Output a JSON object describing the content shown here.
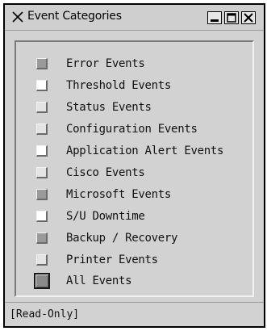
{
  "window": {
    "title": "Event Categories",
    "title_icon": "close-x-icon",
    "controls": {
      "minimize_icon": "minimize-icon",
      "maximize_icon": "maximize-icon",
      "close_icon": "close-icon"
    },
    "background": "#d2d2d2"
  },
  "categories": [
    {
      "label": "Error Events",
      "swatch": "grey"
    },
    {
      "label": "Threshold Events",
      "swatch": "white"
    },
    {
      "label": "Status Events",
      "swatch": "light"
    },
    {
      "label": "Configuration Events",
      "swatch": "light"
    },
    {
      "label": "Application Alert Events",
      "swatch": "white"
    },
    {
      "label": "Cisco Events",
      "swatch": "light"
    },
    {
      "label": "Microsoft Events",
      "swatch": "grey"
    },
    {
      "label": "S/U Downtime",
      "swatch": "white"
    },
    {
      "label": "Backup / Recovery",
      "swatch": "grey"
    },
    {
      "label": "Printer Events",
      "swatch": "light"
    },
    {
      "label": "All Events",
      "swatch": "all"
    }
  ],
  "status": {
    "text": "[Read-Only]"
  }
}
